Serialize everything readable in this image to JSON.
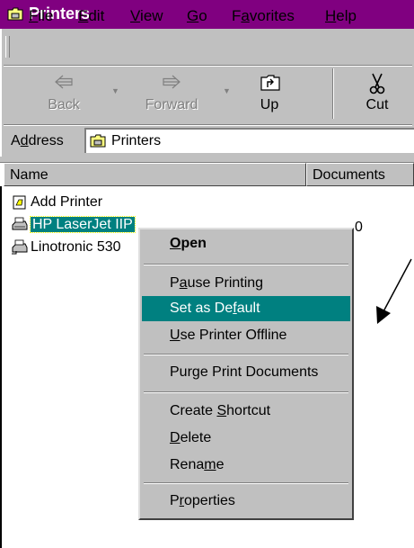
{
  "window": {
    "title": "Printers"
  },
  "menu": [
    {
      "label": "File",
      "u": "F",
      "rest": "ile"
    },
    {
      "label": "Edit",
      "u": "E",
      "rest": "dit"
    },
    {
      "label": "View",
      "u": "V",
      "rest": "iew"
    },
    {
      "label": "Go",
      "u": "G",
      "rest": "o"
    },
    {
      "label": "Favorites",
      "pre": "F",
      "u": "a",
      "rest": "vorites"
    },
    {
      "label": "Help",
      "u": "H",
      "rest": "elp"
    }
  ],
  "toolbar": {
    "back": "Back",
    "forward": "Forward",
    "up": "Up",
    "cut": "Cut"
  },
  "address": {
    "label_pre": "A",
    "label_u": "d",
    "label_rest": "dress",
    "value": "Printers"
  },
  "list": {
    "columns": [
      "Name",
      "Documents"
    ],
    "items": [
      {
        "name": "Add Printer",
        "documents": ""
      },
      {
        "name": "HP LaserJet IIP",
        "documents": "0"
      },
      {
        "name": "Linotronic 530",
        "documents": ""
      }
    ]
  },
  "context_menu": {
    "items": [
      {
        "pre": "",
        "u": "O",
        "rest": "pen"
      },
      {
        "pre": "P",
        "u": "a",
        "rest": "use Printing"
      },
      {
        "pre": "Set as De",
        "u": "f",
        "rest": "ault"
      },
      {
        "pre": "",
        "u": "U",
        "rest": "se Printer Offline"
      },
      {
        "pre": "Pur",
        "u": "g",
        "rest": "e Print Documents"
      },
      {
        "pre": "Create ",
        "u": "S",
        "rest": "hortcut"
      },
      {
        "pre": "",
        "u": "D",
        "rest": "elete"
      },
      {
        "pre": "Rena",
        "u": "m",
        "rest": "e"
      },
      {
        "pre": "P",
        "u": "r",
        "rest": "operties"
      }
    ]
  },
  "colors": {
    "titlebar": "#800080",
    "highlight": "#008080",
    "chrome": "#c0c0c0"
  }
}
